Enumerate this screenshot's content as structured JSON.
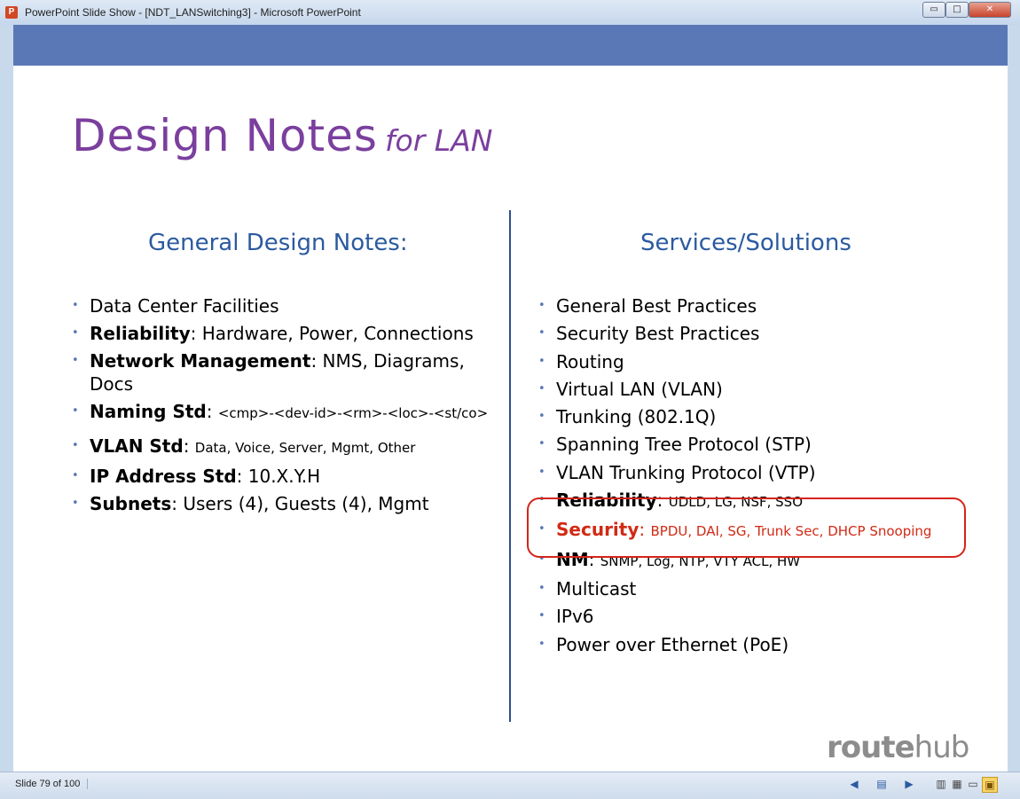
{
  "window": {
    "title": "PowerPoint Slide Show - [NDT_LANSwitching3] - Microsoft PowerPoint",
    "app_icon": "P",
    "controls": {
      "minimize": "▭",
      "maximize": "□",
      "close": "✕"
    }
  },
  "slide": {
    "title_main": "Design Notes",
    "title_sub": "for LAN",
    "left": {
      "heading": "General Design Notes:",
      "items": [
        {
          "key": "",
          "text": "Data Center Facilities"
        },
        {
          "key": "Reliability",
          "text": ": Hardware, Power, Connections"
        },
        {
          "key": "Network Management",
          "text": ": NMS, Diagrams, Docs"
        },
        {
          "key": "Naming Std",
          "text": ": ",
          "small": "<cmp>-<dev-id>-<rm>-<loc>-<st/co>"
        },
        {
          "key": "VLAN Std",
          "text": ": ",
          "small": "Data, Voice, Server, Mgmt, Other"
        },
        {
          "key": "IP Address Std",
          "text": ": 10.X.Y.H"
        },
        {
          "key": "Subnets",
          "text": ": Users (4), Guests (4), Mgmt"
        }
      ]
    },
    "right": {
      "heading": "Services/Solutions",
      "items": [
        {
          "key": "",
          "text": "General Best Practices"
        },
        {
          "key": "",
          "text": "Security Best Practices"
        },
        {
          "key": "",
          "text": "Routing"
        },
        {
          "key": "",
          "text": "Virtual LAN (VLAN)"
        },
        {
          "key": "",
          "text": "Trunking (802.1Q)"
        },
        {
          "key": "",
          "text": "Spanning Tree Protocol (STP)"
        },
        {
          "key": "",
          "text": "VLAN Trunking Protocol (VTP)"
        },
        {
          "key": "Reliability",
          "text": ": ",
          "small": "UDLD, LG, NSF, SSO"
        },
        {
          "key": "Security",
          "text": ": ",
          "small": "BPDU, DAI, SG, Trunk Sec, DHCP Snooping"
        },
        {
          "key": "NM",
          "text": ": ",
          "small": "SNMP, Log, NTP, VTY ACL, HW"
        },
        {
          "key": "",
          "text": "Multicast"
        },
        {
          "key": "",
          "text": "IPv6"
        },
        {
          "key": "",
          "text": "Power over Ethernet (PoE)"
        }
      ]
    },
    "logo": {
      "part1": "route",
      "part2": "hub"
    },
    "colors": {
      "banner": "#5b78b6",
      "title": "#7b3f9e",
      "heading": "#2b5aa0",
      "highlight": "#d4251a"
    }
  },
  "statusbar": {
    "slide_counter": "Slide 79 of 100",
    "nav": {
      "prev": "◀",
      "notes": "▤",
      "next": "▶"
    },
    "views": {
      "normal": "▥",
      "sorter": "▦",
      "reading": "▭",
      "slideshow": "▣"
    }
  }
}
